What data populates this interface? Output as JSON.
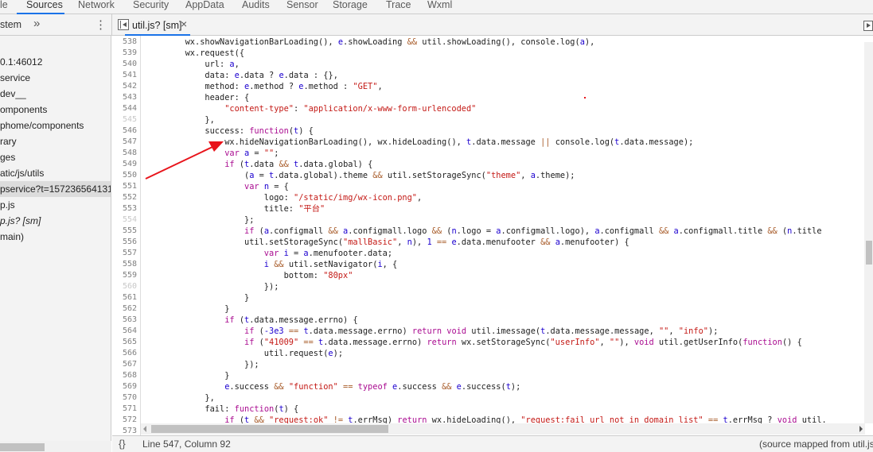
{
  "tabs": [
    {
      "label": "le",
      "active": false
    },
    {
      "label": "Sources",
      "active": true
    },
    {
      "label": "Network",
      "active": false
    },
    {
      "label": "Security",
      "active": false
    },
    {
      "label": "AppData",
      "active": false
    },
    {
      "label": "Audits",
      "active": false
    },
    {
      "label": "Sensor",
      "active": false
    },
    {
      "label": "Storage",
      "active": false
    },
    {
      "label": "Trace",
      "active": false
    },
    {
      "label": "Wxml",
      "active": false
    }
  ],
  "navigator": {
    "tab_label": "stem",
    "more": "»",
    "menu": "⋮"
  },
  "editor_tab": {
    "label": "util.js? [sm]",
    "close": "×"
  },
  "sidebar": {
    "items": [
      {
        "label": "0.1:46012"
      },
      {
        "label": "service"
      },
      {
        "label": "dev__"
      },
      {
        "label": "omponents"
      },
      {
        "label": "phome/components"
      },
      {
        "label": "rary"
      },
      {
        "label": "ges"
      },
      {
        "label": "atic/js/utils"
      },
      {
        "label": "pservice?t=157236564131",
        "selected": true
      },
      {
        "label": "p.js"
      },
      {
        "label": "p.js? [sm]",
        "italic": true
      },
      {
        "label": "main)"
      }
    ]
  },
  "code": {
    "lines": [
      {
        "n": "538",
        "t": "        wx.showNavigationBarLoading(), e.showLoading && util.showLoading(), console.log(a),"
      },
      {
        "n": "539",
        "t": "        wx.request({"
      },
      {
        "n": "540",
        "t": "            url: a,"
      },
      {
        "n": "541",
        "t": "            data: e.data ? e.data : {},"
      },
      {
        "n": "542",
        "t": "            method: e.method ? e.method : \"GET\","
      },
      {
        "n": "543",
        "t": "            header: {"
      },
      {
        "n": "544",
        "t": "                \"content-type\": \"application/x-www-form-urlencoded\""
      },
      {
        "n": "545",
        "t": "            },",
        "dim": true
      },
      {
        "n": "546",
        "t": "            success: function(t) {"
      },
      {
        "n": "547",
        "t": "                wx.hideNavigationBarLoading(), wx.hideLoading(), t.data.message || console.log(t.data.message);"
      },
      {
        "n": "548",
        "t": "                var a = \"\";"
      },
      {
        "n": "549",
        "t": "                if (t.data && t.data.global) {"
      },
      {
        "n": "550",
        "t": "                    (a = t.data.global).theme && util.setStorageSync(\"theme\", a.theme);"
      },
      {
        "n": "551",
        "t": "                    var n = {"
      },
      {
        "n": "552",
        "t": "                        logo: \"/static/img/wx-icon.png\","
      },
      {
        "n": "553",
        "t": "                        title: \"平台\""
      },
      {
        "n": "554",
        "t": "                    };",
        "dim": true
      },
      {
        "n": "555",
        "t": "                    if (a.configmall && a.configmall.logo && (n.logo = a.configmall.logo), a.configmall && a.configmall.title && (n.title"
      },
      {
        "n": "556",
        "t": "                    util.setStorageSync(\"mallBasic\", n), 1 == e.data.menufooter && a.menufooter) {"
      },
      {
        "n": "557",
        "t": "                        var i = a.menufooter.data;"
      },
      {
        "n": "558",
        "t": "                        i && util.setNavigator(i, {"
      },
      {
        "n": "559",
        "t": "                            bottom: \"80px\""
      },
      {
        "n": "560",
        "t": "                        });",
        "dim": true
      },
      {
        "n": "561",
        "t": "                    }"
      },
      {
        "n": "562",
        "t": "                }"
      },
      {
        "n": "563",
        "t": "                if (t.data.message.errno) {"
      },
      {
        "n": "564",
        "t": "                    if (-3e3 == t.data.message.errno) return void util.imessage(t.data.message.message, \"\", \"info\");"
      },
      {
        "n": "565",
        "t": "                    if (\"41009\" == t.data.message.errno) return wx.setStorageSync(\"userInfo\", \"\"), void util.getUserInfo(function() {"
      },
      {
        "n": "566",
        "t": "                        util.request(e);"
      },
      {
        "n": "567",
        "t": "                    });"
      },
      {
        "n": "568",
        "t": "                }"
      },
      {
        "n": "569",
        "t": "                e.success && \"function\" == typeof e.success && e.success(t);"
      },
      {
        "n": "570",
        "t": "            },"
      },
      {
        "n": "571",
        "t": "            fail: function(t) {"
      },
      {
        "n": "572",
        "t": "                if (t && \"request:ok\" != t.errMsg) return wx.hideLoading(), \"request:fail url not in domain list\" == t.errMsg ? void util."
      },
      {
        "n": "573",
        "t": ""
      }
    ]
  },
  "status": {
    "braces": "{}",
    "position": "Line 547, Column 92",
    "source_mapped": "(source mapped from util.js)"
  },
  "colors": {
    "accent": "#1a73e8",
    "keyword": "#aa0d91",
    "string": "#c41a16",
    "variable": "#1c00cf",
    "annotation_arrow": "#e8141b"
  },
  "annotation": {
    "type": "red-arrow",
    "points_to_line": "547"
  }
}
